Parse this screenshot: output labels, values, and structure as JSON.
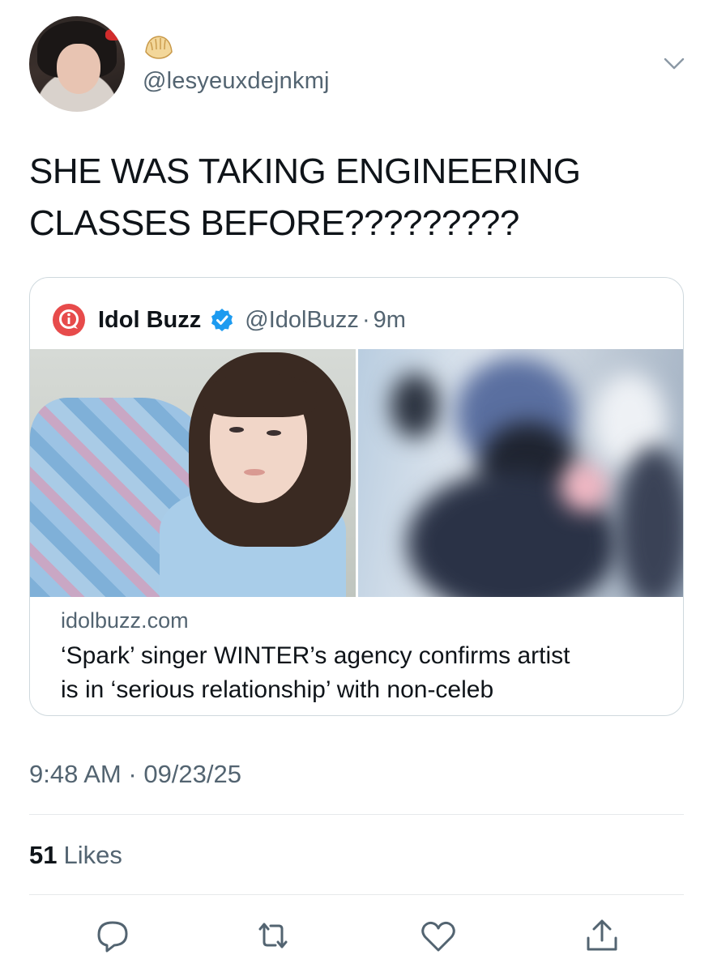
{
  "author": {
    "handle": "@lesyeuxdejnkmj",
    "badge_icon": "dumpling-emoji-icon"
  },
  "tweet": {
    "text_lines": [
      "SHE WAS TAKING ENGINEERING",
      "CLASSES BEFORE?????????"
    ]
  },
  "quote": {
    "name": "Idol Buzz",
    "handle": "@IdolBuzz",
    "separator": "·",
    "time": "9m",
    "verified": true,
    "link_domain": "idolbuzz.com",
    "link_title_lines": [
      "‘Spark’ singer WINTER’s agency confirms artist",
      "is in ‘serious relationship’ with non-celeb"
    ]
  },
  "meta": {
    "time": "9:48 AM",
    "separator": "·",
    "date": "09/23/25",
    "likes_count": "51",
    "likes_label": "Likes"
  },
  "actions": [
    "reply-icon",
    "retweet-icon",
    "like-icon",
    "share-icon"
  ],
  "colors": {
    "text": "#0f1419",
    "secondary": "#536471",
    "verified_blue": "#1d9bf0",
    "idolbuzz_red": "#e74b4b",
    "border": "#cfd9de"
  }
}
